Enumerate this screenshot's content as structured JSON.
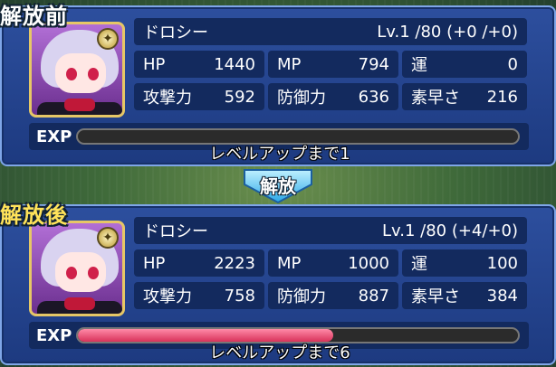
{
  "before": {
    "title": "解放前",
    "name": "ドロシー",
    "level": "Lv.1 /80 (+0 /+0)",
    "stats": [
      {
        "label": "HP",
        "value": "1440"
      },
      {
        "label": "MP",
        "value": "794"
      },
      {
        "label": "運",
        "value": "0"
      },
      {
        "label": "攻撃力",
        "value": "592"
      },
      {
        "label": "防御力",
        "value": "636"
      },
      {
        "label": "素早さ",
        "value": "216"
      }
    ],
    "exp_label": "EXP",
    "exp_progress": 0.0,
    "levelup_text": "レベルアップまで1"
  },
  "release_label": "解放",
  "after": {
    "title": "解放後",
    "name": "ドロシー",
    "level": "Lv.1 /80 (+4/+0)",
    "stats": [
      {
        "label": "HP",
        "value": "2223"
      },
      {
        "label": "MP",
        "value": "1000"
      },
      {
        "label": "運",
        "value": "100"
      },
      {
        "label": "攻撃力",
        "value": "758"
      },
      {
        "label": "防御力",
        "value": "887"
      },
      {
        "label": "素早さ",
        "value": "384"
      }
    ],
    "exp_label": "EXP",
    "exp_progress": 0.58,
    "levelup_text": "レベルアップまで6"
  },
  "colors": {
    "panel": "#1d3a80",
    "panel_border": "#7fa6e8",
    "exp_fill": "#d8325a",
    "title_gold": "#ffe35a"
  }
}
